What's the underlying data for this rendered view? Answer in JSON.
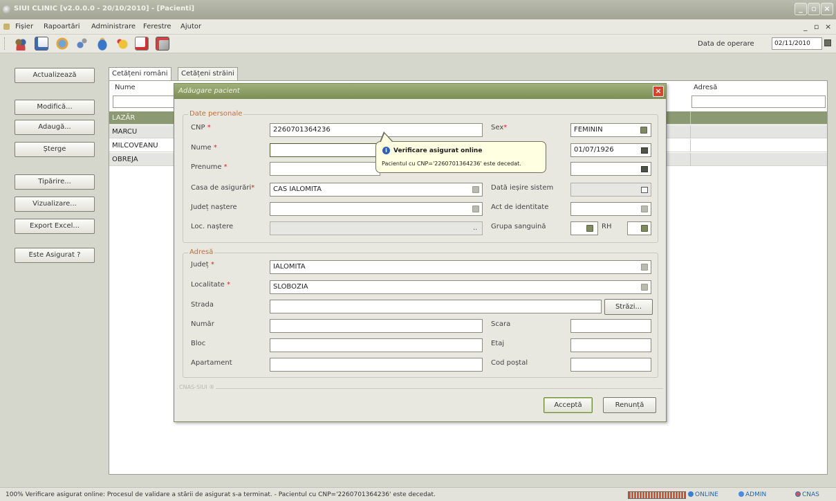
{
  "window": {
    "title": "SIUI CLINIC [v2.0.0.0 - 20/10/2010] - [Pacienti]"
  },
  "menu": {
    "items": [
      "Fișier",
      "Rapoartări",
      "Administrare",
      "Ferestre",
      "Ajutor"
    ],
    "mdi_controls": [
      "_",
      "▫",
      "×"
    ]
  },
  "toolbar": {
    "operation_date_label": "Data de operare",
    "operation_date": "02/11/2010"
  },
  "left_panel": {
    "buttons": [
      "Actualizează",
      "Modifică...",
      "Adaugă...",
      "Șterge",
      "Tipărire...",
      "Vizualizare...",
      "Export Excel...",
      "Este Asigurat ?"
    ]
  },
  "tabs": [
    "Cetățeni români",
    "Cetățeni străini"
  ],
  "grid": {
    "columns": [
      "Nume",
      "Adresă"
    ],
    "rows": [
      "LAZĂR",
      "MARCU",
      "MILCOVEANU",
      "OBREJA"
    ]
  },
  "dialog": {
    "title": "Adăugare pacient",
    "personal_legend": "Date personale",
    "address_legend": "Adresă",
    "footer_legend": "CNAS-SIUI ®",
    "fields": {
      "cnp_label": "CNP",
      "cnp_value": "2260701364236",
      "nume_label": "Nume",
      "prenume_label": "Prenume",
      "casa_label": "Casa de asigurări",
      "casa_value": "CAS IALOMITA",
      "judet_nastere_label": "Județ naștere",
      "loc_nastere_label": "Loc. naștere",
      "sex_label": "Sex",
      "sex_value": "FEMININ",
      "data_nasterii_value": "01/07/1926",
      "data_iesire_label": "Dată ieșire sistem",
      "act_label": "Act de identitate",
      "grupa_label": "Grupa sanguină",
      "rh_label": "RH",
      "judet_label": "Județ",
      "judet_value": "IALOMITA",
      "localitate_label": "Localitate",
      "localitate_value": "SLOBOZIA",
      "strada_label": "Strada",
      "strazi_button": "Străzi...",
      "numar_label": "Număr",
      "scara_label": "Scara",
      "bloc_label": "Bloc",
      "etaj_label": "Etaj",
      "apartament_label": "Apartament",
      "cod_postal_label": "Cod poștal"
    },
    "accept_button": "Acceptă",
    "cancel_button": "Renunță"
  },
  "balloon": {
    "title": "Verificare asigurat online",
    "text": "Pacientul cu CNP='2260701364236' este decedat."
  },
  "statusbar": {
    "message": "100% Verificare asigurat online: Procesul de validare a stării de asigurat s-a terminat. - Pacientul cu CNP='2260701364236' este decedat.",
    "online": "ONLINE",
    "user": "ADMIN",
    "cnas": "CNAS"
  },
  "colors": {
    "accent": "#8c9a73",
    "dialog_title": "#7c8e55",
    "legend": "#c26e3c",
    "required": "#d22222"
  }
}
